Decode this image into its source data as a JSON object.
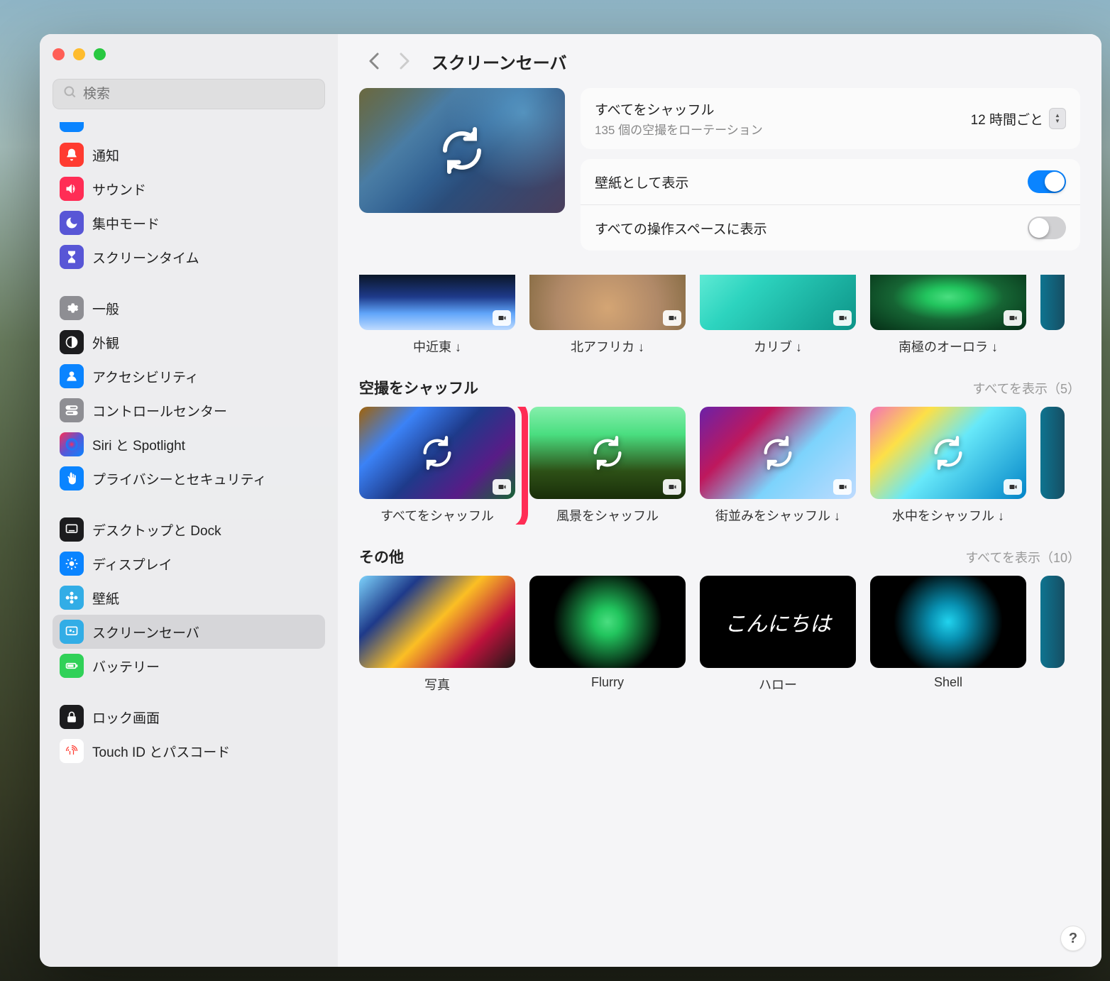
{
  "search_placeholder": "検索",
  "sidebar": [
    {
      "label": "通知",
      "color": "#ff3b30",
      "icon": "bell"
    },
    {
      "label": "サウンド",
      "color": "#ff2d55",
      "icon": "speaker"
    },
    {
      "label": "集中モード",
      "color": "#5856d6",
      "icon": "moon"
    },
    {
      "label": "スクリーンタイム",
      "color": "#5856d6",
      "icon": "hourglass"
    },
    {
      "spacer": true
    },
    {
      "label": "一般",
      "color": "#8e8e93",
      "icon": "gear"
    },
    {
      "label": "外観",
      "color": "#1c1c1e",
      "icon": "appearance"
    },
    {
      "label": "アクセシビリティ",
      "color": "#0a84ff",
      "icon": "person"
    },
    {
      "label": "コントロールセンター",
      "color": "#8e8e93",
      "icon": "switches"
    },
    {
      "label": "Siri と Spotlight",
      "color": "linear-gradient(135deg,#ff2d55,#5856d6,#0a84ff)",
      "icon": "siri"
    },
    {
      "label": "プライバシーとセキュリティ",
      "color": "#0a84ff",
      "icon": "hand"
    },
    {
      "spacer": true
    },
    {
      "label": "デスクトップと Dock",
      "color": "#1c1c1e",
      "icon": "dock"
    },
    {
      "label": "ディスプレイ",
      "color": "#0a84ff",
      "icon": "brightness"
    },
    {
      "label": "壁紙",
      "color": "#32ade6",
      "icon": "flower"
    },
    {
      "label": "スクリーンセーバ",
      "color": "#32ade6",
      "icon": "screensaver",
      "selected": true
    },
    {
      "label": "バッテリー",
      "color": "#30d158",
      "icon": "battery"
    },
    {
      "spacer": true
    },
    {
      "label": "ロック画面",
      "color": "#1c1c1e",
      "icon": "lock"
    },
    {
      "label": "Touch ID とパスコード",
      "color": "#ffffff",
      "icon": "fingerprint",
      "textcolor": "#ff3b30"
    }
  ],
  "title": "スクリーンセーバ",
  "settings": {
    "shuffle_label": "すべてをシャッフル",
    "shuffle_sub": "135 個の空撮をローテーション",
    "interval": "12 時間ごと",
    "wallpaper_label": "壁紙として表示",
    "wallpaper_on": true,
    "allspaces_label": "すべての操作スペースに表示",
    "allspaces_on": false
  },
  "row1": [
    {
      "label": "中近東 ↓",
      "klass": "g-earth"
    },
    {
      "label": "北アフリカ ↓",
      "klass": "g-desert"
    },
    {
      "label": "カリブ ↓",
      "klass": "g-carib"
    },
    {
      "label": "南極のオーロラ ↓",
      "klass": "g-aurora"
    }
  ],
  "section2": {
    "title": "空撮をシャッフル",
    "more": "すべてを表示（5）",
    "items": [
      {
        "label": "すべてをシャッフル",
        "klass": "g-collage1",
        "highlight": true
      },
      {
        "label": "風景をシャッフル",
        "klass": "g-landscape"
      },
      {
        "label": "街並みをシャッフル ↓",
        "klass": "g-city"
      },
      {
        "label": "水中をシャッフル ↓",
        "klass": "g-underwater"
      }
    ]
  },
  "section3": {
    "title": "その他",
    "more": "すべてを表示（10）",
    "items": [
      {
        "label": "写真",
        "klass": "g-photos",
        "nobadge": true
      },
      {
        "label": "Flurry",
        "klass": "g-flurry",
        "nobadge": true
      },
      {
        "label": "ハロー",
        "klass": "g-hello",
        "nobadge": true,
        "text": "こんにちは"
      },
      {
        "label": "Shell",
        "klass": "g-shell",
        "nobadge": true
      }
    ]
  },
  "help": "?"
}
